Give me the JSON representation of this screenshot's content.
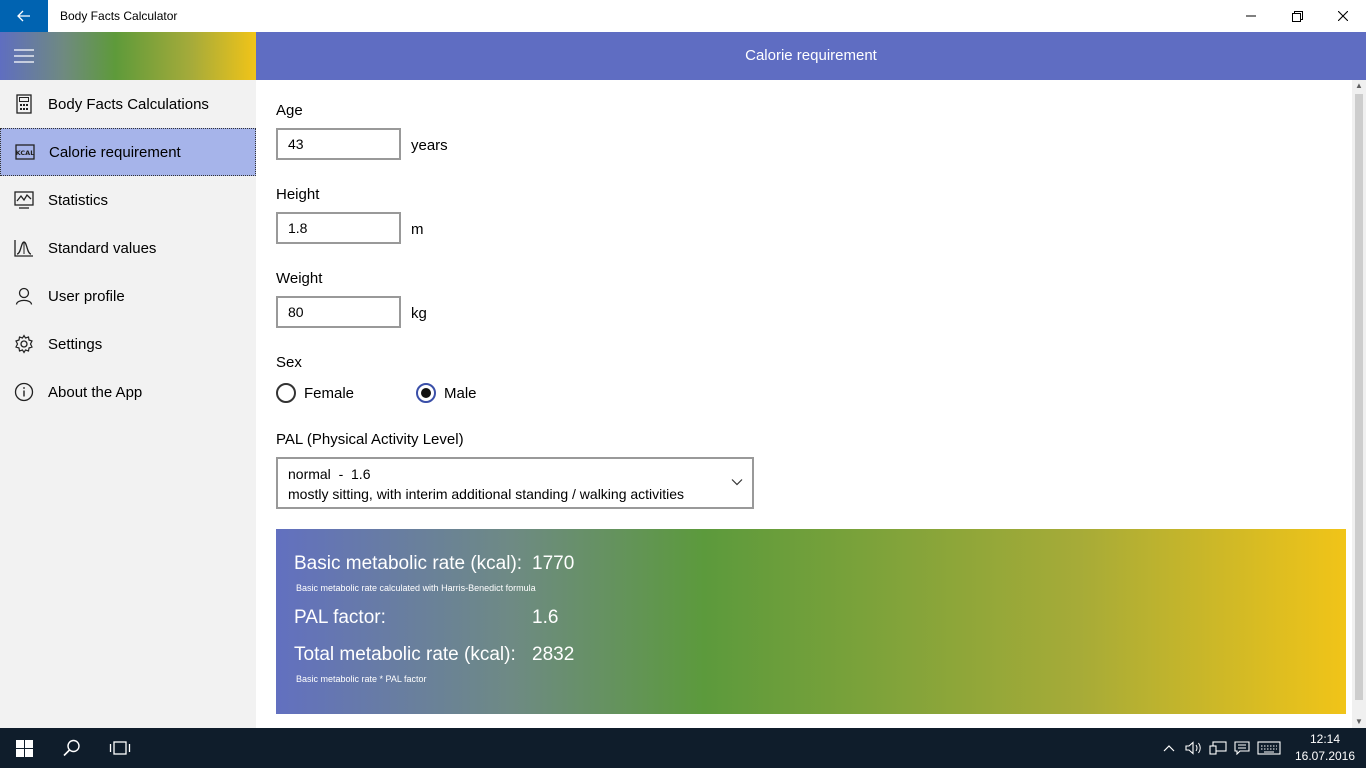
{
  "window": {
    "title": "Body Facts Calculator"
  },
  "sidebar": {
    "items": [
      {
        "label": "Body Facts Calculations",
        "icon": "calculator-icon"
      },
      {
        "label": "Calorie requirement",
        "icon": "kcal-icon",
        "selected": true
      },
      {
        "label": "Statistics",
        "icon": "chart-icon"
      },
      {
        "label": "Standard values",
        "icon": "bell-curve-icon"
      },
      {
        "label": "User profile",
        "icon": "user-icon"
      },
      {
        "label": "Settings",
        "icon": "gear-icon"
      },
      {
        "label": "About the App",
        "icon": "info-icon"
      }
    ]
  },
  "header": {
    "title": "Calorie requirement"
  },
  "form": {
    "age": {
      "label": "Age",
      "value": "43",
      "unit": "years"
    },
    "height": {
      "label": "Height",
      "value": "1.8",
      "unit": "m"
    },
    "weight": {
      "label": "Weight",
      "value": "80",
      "unit": "kg"
    },
    "sex": {
      "label": "Sex",
      "options": [
        {
          "label": "Female",
          "checked": false
        },
        {
          "label": "Male",
          "checked": true
        }
      ]
    },
    "pal": {
      "label": "PAL (Physical Activity Level)",
      "selected_line1": "normal  -  1.6",
      "selected_line2": "mostly sitting, with interim additional standing / walking activities"
    }
  },
  "results": {
    "bmr_label": "Basic metabolic rate (kcal):",
    "bmr_value": "1770",
    "bmr_note": "Basic metabolic rate calculated with Harris-Benedict formula",
    "pal_label": "PAL factor:",
    "pal_value": "1.6",
    "total_label": "Total metabolic rate (kcal):",
    "total_value": "2832",
    "total_note": "Basic metabolic rate * PAL factor"
  },
  "taskbar": {
    "time": "12:14",
    "date": "16.07.2016"
  },
  "colors": {
    "accent": "#5f6dc2",
    "selected_nav": "#a6b4ea",
    "back_button": "#0063b1",
    "taskbar": "#0f1d2b"
  }
}
